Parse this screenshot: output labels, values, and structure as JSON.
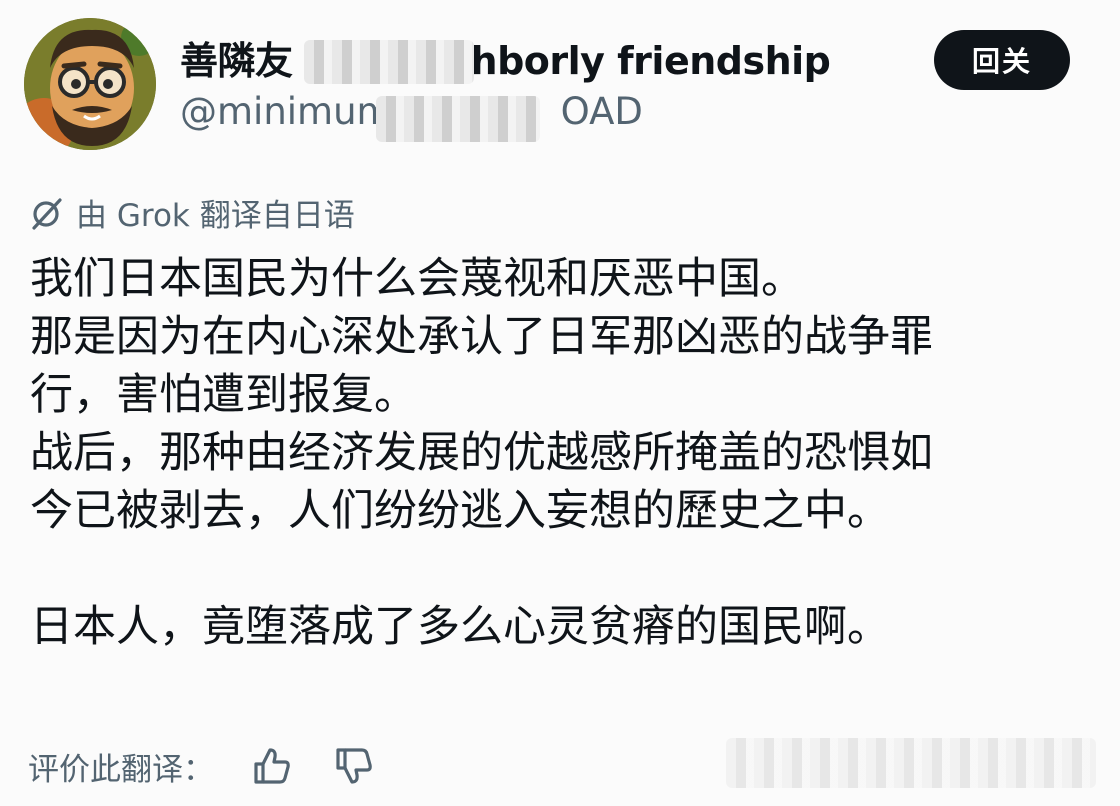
{
  "profile": {
    "display_name_visible_start": "善隣友",
    "display_name_visible_end": "hborly friendship",
    "handle_visible_start": "@minimum",
    "handle_visible_end": "OAD"
  },
  "follow_button": {
    "label": "回关"
  },
  "translation": {
    "note": "由 Grok 翻译自日语"
  },
  "post": {
    "lines": [
      "我们日本国民为什么会蔑视和厌恶中国。",
      "那是因为在内心深处承认了日军那凶恶的战争罪",
      "行，害怕遭到报复。",
      "战后，那种由经济发展的优越感所掩盖的恐惧如",
      "今已被剥去，人们纷纷逃入妄想的歷史之中。",
      "",
      "日本人，竟堕落成了多么心灵贫瘠的国民啊。"
    ]
  },
  "rating": {
    "prompt": "评价此翻译："
  }
}
